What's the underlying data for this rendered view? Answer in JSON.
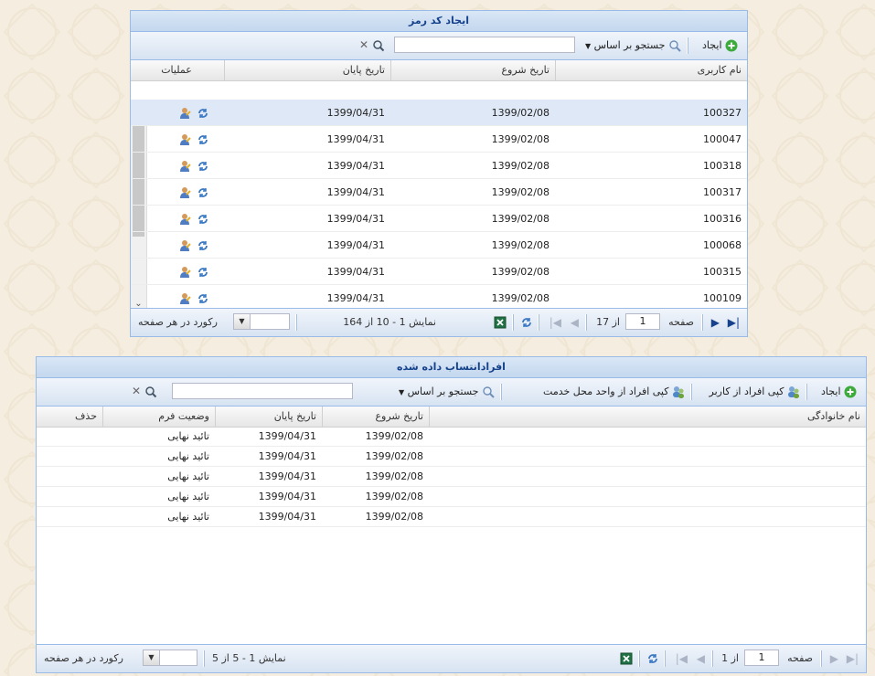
{
  "panel1": {
    "title": "ایجاد کد رمز",
    "toolbar": {
      "create_label": "ایجاد",
      "search_by_label": "جستجو بر اساس",
      "search_value": ""
    },
    "columns": [
      "نام کاربری",
      "تاریخ شروع",
      "تاریخ پایان",
      "عملیات"
    ],
    "rows": [
      {
        "user": "100327",
        "start": "1399/02/08",
        "end": "1399/04/31"
      },
      {
        "user": "100047",
        "start": "1399/02/08",
        "end": "1399/04/31"
      },
      {
        "user": "100318",
        "start": "1399/02/08",
        "end": "1399/04/31"
      },
      {
        "user": "100317",
        "start": "1399/02/08",
        "end": "1399/04/31"
      },
      {
        "user": "100316",
        "start": "1399/02/08",
        "end": "1399/04/31"
      },
      {
        "user": "100068",
        "start": "1399/02/08",
        "end": "1399/04/31"
      },
      {
        "user": "100315",
        "start": "1399/02/08",
        "end": "1399/04/31"
      },
      {
        "user": "100109",
        "start": "1399/02/08",
        "end": "1399/04/31"
      }
    ],
    "pager": {
      "page_label": "صفحه",
      "page_value": "1",
      "of_label": "از 17",
      "display_text": "نمایش 1 - 10 از 164",
      "per_page_label": "رکورد در هر صفحه"
    }
  },
  "panel2": {
    "title": "افرادانتساب داده شده",
    "toolbar": {
      "create_label": "ایجاد",
      "copy_from_user_label": "کپی افراد از کاربر",
      "copy_from_unit_label": "کپی افراد از واحد محل خدمت",
      "search_by_label": "جستجو بر اساس",
      "search_value": ""
    },
    "columns": [
      "نام خانوادگی",
      "تاریخ شروع",
      "تاریخ پایان",
      "وضعیت فرم",
      "حذف"
    ],
    "rows": [
      {
        "start": "1399/02/08",
        "end": "1399/04/31",
        "status": "تائید نهایی"
      },
      {
        "start": "1399/02/08",
        "end": "1399/04/31",
        "status": "تائید نهایی"
      },
      {
        "start": "1399/02/08",
        "end": "1399/04/31",
        "status": "تائید نهایی"
      },
      {
        "start": "1399/02/08",
        "end": "1399/04/31",
        "status": "تائید نهایی"
      },
      {
        "start": "1399/02/08",
        "end": "1399/04/31",
        "status": "تائید نهایی"
      }
    ],
    "pager": {
      "page_label": "صفحه",
      "page_value": "1",
      "of_label": "از 1",
      "display_text": "نمایش 1 - 5 از 5",
      "per_page_label": "رکورد در هر صفحه"
    }
  },
  "colors": {
    "accent": "#15428b",
    "border": "#99bbe8",
    "selected_row": "#dfe8f6",
    "background": "#f4ede0"
  },
  "icons": [
    "add-icon",
    "search-icon",
    "clear-icon",
    "user-edit-icon",
    "refresh-icon",
    "copy-user-icon",
    "excel-icon",
    "first-page-icon",
    "prev-page-icon",
    "next-page-icon",
    "last-page-icon",
    "dropdown-icon"
  ]
}
